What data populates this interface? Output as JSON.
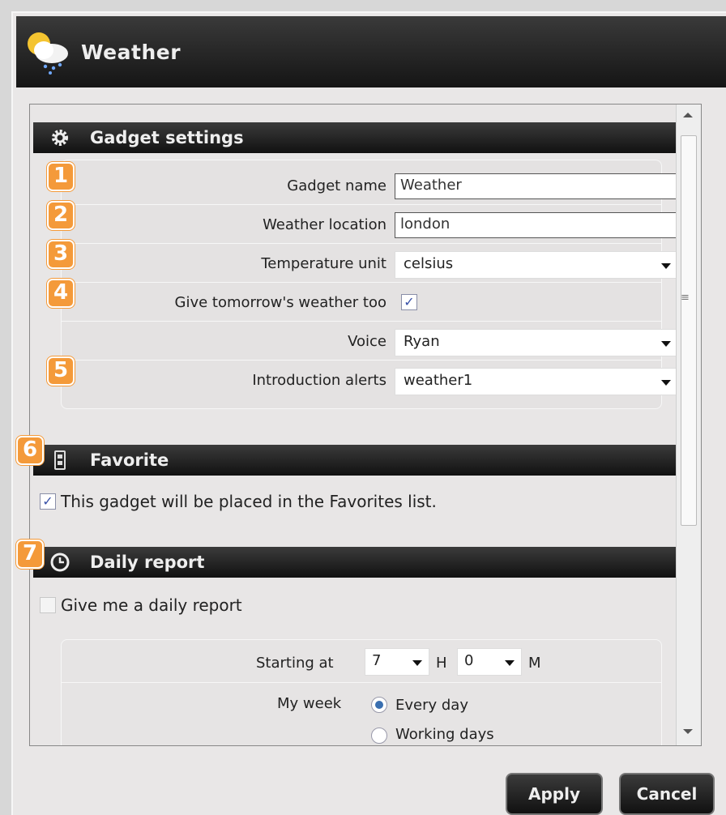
{
  "window": {
    "title": "Weather",
    "icon": "weather-cloud-sun-icon"
  },
  "sections": {
    "gadget_settings": {
      "title": "Gadget settings",
      "icon": "gear-icon"
    },
    "favorite": {
      "title": "Favorite",
      "icon": "favorite-icon"
    },
    "daily_report": {
      "title": "Daily report",
      "icon": "clock-icon"
    }
  },
  "settings": {
    "gadget_name": {
      "label": "Gadget name",
      "value": "Weather"
    },
    "weather_location": {
      "label": "Weather location",
      "value": "london"
    },
    "temperature_unit": {
      "label": "Temperature unit",
      "value": "celsius"
    },
    "tomorrow": {
      "label": "Give tomorrow's weather too",
      "checked": true
    },
    "voice": {
      "label": "Voice",
      "value": "Ryan"
    },
    "intro_alerts": {
      "label": "Introduction alerts",
      "value": "weather1"
    }
  },
  "favorite": {
    "text": "This gadget will be placed in the Favorites list.",
    "checked": true
  },
  "daily": {
    "give_report": {
      "text": "Give me a daily report",
      "checked": false
    },
    "starting_label": "Starting at",
    "hour": "7",
    "hour_unit": "H",
    "minute": "0",
    "minute_unit": "M",
    "week_label": "My week",
    "week_options": [
      "Every day",
      "Working days"
    ],
    "week_selected": "Every day"
  },
  "badges": [
    "1",
    "2",
    "3",
    "4",
    "5",
    "6",
    "7"
  ],
  "buttons": {
    "apply": "Apply",
    "cancel": "Cancel"
  },
  "colors": {
    "badge": "#f49a3a",
    "header": "#1a1a1a",
    "checkmark": "#3952a8"
  }
}
